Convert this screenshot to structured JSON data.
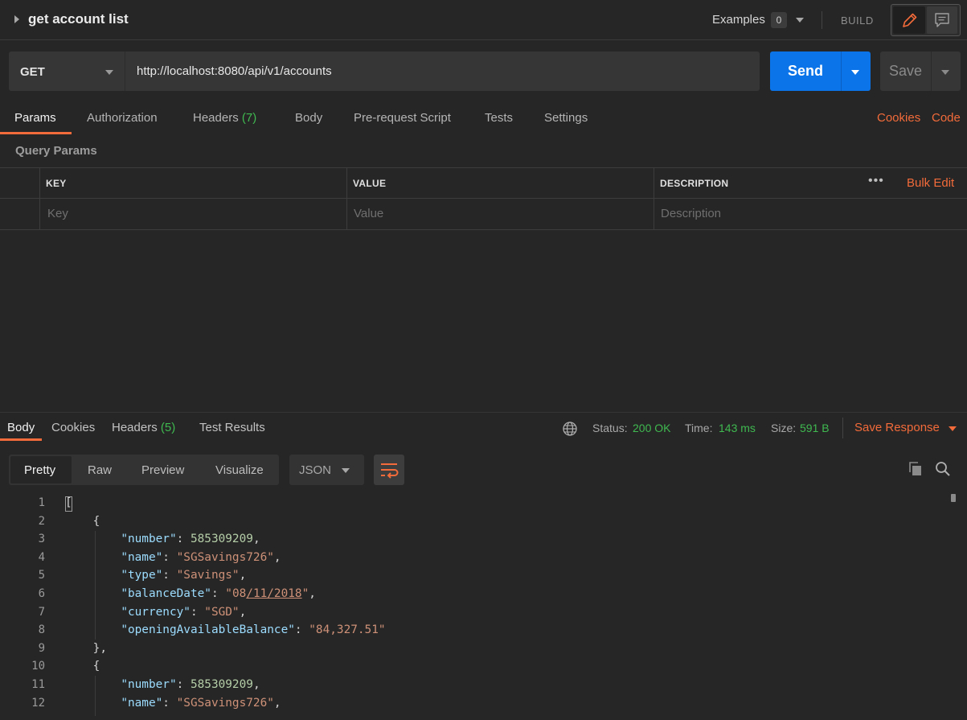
{
  "request": {
    "title": "get account list",
    "examples_label": "Examples",
    "examples_count": "0",
    "build_label": "BUILD",
    "method": "GET",
    "url": "http://localhost:8080/api/v1/accounts",
    "send_label": "Send",
    "save_label": "Save"
  },
  "request_tabs": {
    "params": "Params",
    "authorization": "Authorization",
    "headers": "Headers",
    "headers_count": "(7)",
    "body": "Body",
    "prerequest": "Pre-request Script",
    "tests": "Tests",
    "settings": "Settings",
    "cookies": "Cookies",
    "code": "Code"
  },
  "query_params": {
    "label": "Query Params",
    "columns": [
      "KEY",
      "VALUE",
      "DESCRIPTION"
    ],
    "bulk_edit": "Bulk Edit",
    "more": "•••",
    "placeholders": [
      "Key",
      "Value",
      "Description"
    ]
  },
  "response": {
    "tabs": {
      "body": "Body",
      "cookies": "Cookies",
      "headers": "Headers",
      "headers_count": "(5)",
      "test_results": "Test Results"
    },
    "status_label": "Status:",
    "status": "200 OK",
    "time_label": "Time:",
    "time": "143 ms",
    "size_label": "Size:",
    "size": "591 B",
    "save_response": "Save Response",
    "views": [
      "Pretty",
      "Raw",
      "Preview",
      "Visualize"
    ],
    "format": "JSON"
  },
  "code": {
    "line_numbers": [
      "1",
      "2",
      "3",
      "4",
      "5",
      "6",
      "7",
      "8",
      "9",
      "10",
      "11",
      "12"
    ],
    "lines": [
      {
        "parts": [
          {
            "t": "[",
            "c": "p"
          }
        ]
      },
      {
        "parts": [
          {
            "t": "    {",
            "c": "p"
          }
        ]
      },
      {
        "parts": [
          {
            "t": "        ",
            "c": "p"
          },
          {
            "t": "\"number\"",
            "c": "k"
          },
          {
            "t": ": ",
            "c": "p"
          },
          {
            "t": "585309209",
            "c": "n"
          },
          {
            "t": ",",
            "c": "p"
          }
        ]
      },
      {
        "parts": [
          {
            "t": "        ",
            "c": "p"
          },
          {
            "t": "\"name\"",
            "c": "k"
          },
          {
            "t": ": ",
            "c": "p"
          },
          {
            "t": "\"SGSavings726\"",
            "c": "s"
          },
          {
            "t": ",",
            "c": "p"
          }
        ]
      },
      {
        "parts": [
          {
            "t": "        ",
            "c": "p"
          },
          {
            "t": "\"type\"",
            "c": "k"
          },
          {
            "t": ": ",
            "c": "p"
          },
          {
            "t": "\"Savings\"",
            "c": "s"
          },
          {
            "t": ",",
            "c": "p"
          }
        ]
      },
      {
        "parts": [
          {
            "t": "        ",
            "c": "p"
          },
          {
            "t": "\"balanceDate\"",
            "c": "k"
          },
          {
            "t": ": ",
            "c": "p"
          },
          {
            "t": "\"08",
            "c": "s"
          },
          {
            "t": "/11/2018",
            "c": "s u"
          },
          {
            "t": "\"",
            "c": "s"
          },
          {
            "t": ",",
            "c": "p"
          }
        ]
      },
      {
        "parts": [
          {
            "t": "        ",
            "c": "p"
          },
          {
            "t": "\"currency\"",
            "c": "k"
          },
          {
            "t": ": ",
            "c": "p"
          },
          {
            "t": "\"SGD\"",
            "c": "s"
          },
          {
            "t": ",",
            "c": "p"
          }
        ]
      },
      {
        "parts": [
          {
            "t": "        ",
            "c": "p"
          },
          {
            "t": "\"openingAvailableBalance\"",
            "c": "k"
          },
          {
            "t": ": ",
            "c": "p"
          },
          {
            "t": "\"84,327.51\"",
            "c": "s"
          }
        ]
      },
      {
        "parts": [
          {
            "t": "    },",
            "c": "p"
          }
        ]
      },
      {
        "parts": [
          {
            "t": "    {",
            "c": "p"
          }
        ]
      },
      {
        "parts": [
          {
            "t": "        ",
            "c": "p"
          },
          {
            "t": "\"number\"",
            "c": "k"
          },
          {
            "t": ": ",
            "c": "p"
          },
          {
            "t": "585309209",
            "c": "n"
          },
          {
            "t": ",",
            "c": "p"
          }
        ]
      },
      {
        "parts": [
          {
            "t": "        ",
            "c": "p"
          },
          {
            "t": "\"name\"",
            "c": "k"
          },
          {
            "t": ": ",
            "c": "p"
          },
          {
            "t": "\"SGSavings726\"",
            "c": "s"
          },
          {
            "t": ",",
            "c": "p"
          }
        ]
      }
    ]
  },
  "colors": {
    "accent": "#f26b3a",
    "send": "#0b74e8",
    "status_ok": "#3fb950",
    "json_key": "#9cdcfe",
    "json_number": "#b5cea8",
    "json_string": "#ce9178"
  },
  "icons": [
    "caret-right-icon",
    "chevron-down-icon",
    "pencil-icon",
    "comment-icon",
    "globe-icon",
    "copy-icon",
    "search-icon",
    "wrap-lines-icon"
  ]
}
